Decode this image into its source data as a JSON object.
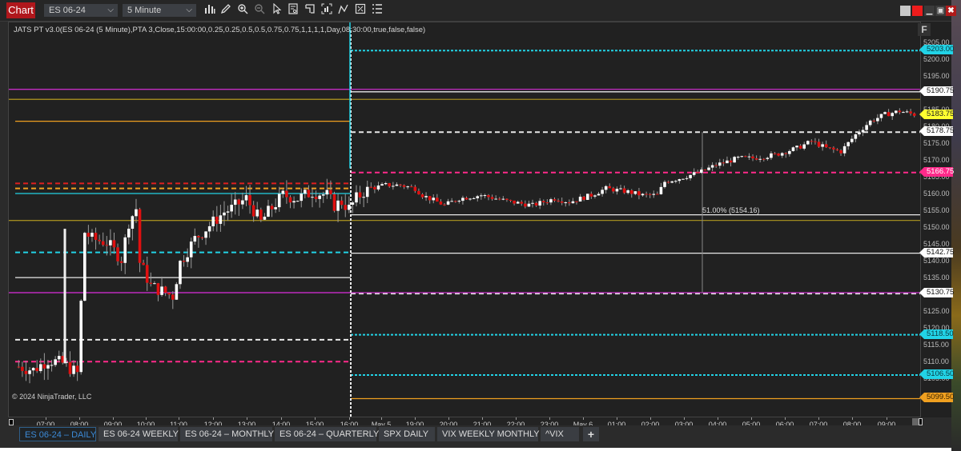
{
  "window": {
    "title_tab": "Chart",
    "instrument": "ES 06-24",
    "interval": "5 Minute",
    "toolbar_icons": [
      "bar-type-icon",
      "pencil-icon",
      "zoom-in-icon",
      "zoom-out-icon",
      "pointer-icon",
      "data-box-icon",
      "properties-icon",
      "chart-trader-icon",
      "strategy-icon",
      "indicators-icon",
      "list-icon"
    ],
    "window_buttons": [
      "gray-box",
      "red-box",
      "minimize",
      "maximize",
      "close"
    ],
    "f_button": "F"
  },
  "indicator_label": "JATS PT v3.0(ES 06-24 (5 Minute),PTA 3,Close,15:00:00,0.25,0.25,0.5,0.5,0.75,0.75,1,1,1,1,Day,08:30:00,true,false,false)",
  "copyright": "© 2024 NinjaTrader, LLC",
  "fib_label": "51.00% (5154.16)",
  "colors": {
    "background": "#212121",
    "up_candle": "#ffffff",
    "down_candle": "#e01010",
    "cyan": "#22d3e6",
    "magenta": "#c42cc4",
    "pink": "#ff2a8a",
    "gold": "#a08a20",
    "orange": "#f0a020",
    "red": "#e02020",
    "yellow": "#ffff30"
  },
  "y_axis": {
    "ticks": [
      "5205.00",
      "5200.00",
      "5195.00",
      "5185.00",
      "5180.00",
      "5175.00",
      "5170.00",
      "5165.00",
      "5160.00",
      "5155.00",
      "5150.00",
      "5145.00",
      "5140.00",
      "5135.00",
      "5125.00",
      "5120.00",
      "5115.00",
      "5110.00",
      "5105.00"
    ],
    "tick_values": [
      5205,
      5200,
      5195,
      5185,
      5180,
      5175,
      5170,
      5165,
      5160,
      5155,
      5150,
      5145,
      5140,
      5135,
      5125,
      5120,
      5115,
      5110,
      5105
    ]
  },
  "price_labels": [
    {
      "value": "5203.00",
      "style": "cyan"
    },
    {
      "value": "5190.75",
      "style": "white"
    },
    {
      "value": "5183.75",
      "style": "yellow"
    },
    {
      "value": "5178.75",
      "style": "white"
    },
    {
      "value": "5166.75",
      "style": "pink"
    },
    {
      "value": "5142.75",
      "style": "white"
    },
    {
      "value": "5130.75",
      "style": "white"
    },
    {
      "value": "5118.50",
      "style": "cyan"
    },
    {
      "value": "5106.50",
      "style": "cyan"
    },
    {
      "value": "5099.50",
      "style": "orange"
    }
  ],
  "x_axis": {
    "ticks": [
      "07:00",
      "08:00",
      "09:00",
      "10:00",
      "11:00",
      "12:00",
      "13:00",
      "14:00",
      "15:00",
      "16:00",
      "May 5",
      "19:00",
      "20:00",
      "21:00",
      "22:00",
      "23:00",
      "May 6",
      "01:00",
      "02:00",
      "03:00",
      "04:00",
      "05:00",
      "06:00",
      "07:00",
      "08:00",
      "09:00"
    ]
  },
  "chart_tabs": [
    {
      "label": "ES 06-24 – DAILY",
      "active": true
    },
    {
      "label": "ES 06-24 WEEKLY",
      "active": false
    },
    {
      "label": "ES 06-24 – MONTHLY",
      "active": false
    },
    {
      "label": "ES 06-24 – QUARTERLY",
      "active": false
    },
    {
      "label": "SPX DAILY",
      "active": false
    },
    {
      "label": "VIX WEEKLY MONTHLY",
      "active": false
    },
    {
      "label": "^VIX",
      "active": false
    }
  ],
  "add_tab": "+",
  "chart_data": {
    "type": "candlestick",
    "instrument": "ES 06-24",
    "interval": "5 Minute",
    "y_range": [
      5097,
      5209
    ],
    "levels_current_session": [
      {
        "price": 5203.0,
        "color": "cyan",
        "style": "dashed"
      },
      {
        "price": 5190.75,
        "color": "white",
        "style": "solid"
      },
      {
        "price": 5191.5,
        "color": "magenta",
        "style": "solid"
      },
      {
        "price": 5188.5,
        "color": "gold",
        "style": "solid"
      },
      {
        "price": 5178.75,
        "color": "white",
        "style": "dashed"
      },
      {
        "price": 5166.75,
        "color": "pink",
        "style": "dashed"
      },
      {
        "price": 5154.16,
        "color": "white",
        "style": "solid",
        "label": "51.00%"
      },
      {
        "price": 5152.5,
        "color": "gold",
        "style": "solid"
      },
      {
        "price": 5142.75,
        "color": "white",
        "style": "solid"
      },
      {
        "price": 5130.75,
        "color": "white",
        "style": "dashed"
      },
      {
        "price": 5131.0,
        "color": "magenta",
        "style": "solid"
      },
      {
        "price": 5118.5,
        "color": "cyan",
        "style": "dashed"
      },
      {
        "price": 5106.5,
        "color": "cyan",
        "style": "dashed"
      },
      {
        "price": 5099.5,
        "color": "orange",
        "style": "solid"
      }
    ],
    "levels_prior_session": [
      {
        "price": 5191.5,
        "color": "magenta",
        "style": "solid"
      },
      {
        "price": 5188.5,
        "color": "gold",
        "style": "solid"
      },
      {
        "price": 5182.0,
        "color": "orange",
        "style": "solid"
      },
      {
        "price": 5163.5,
        "color": "red",
        "style": "dashed"
      },
      {
        "price": 5162.0,
        "color": "orange",
        "style": "dashed"
      },
      {
        "price": 5160.5,
        "color": "cyan",
        "style": "solid"
      },
      {
        "price": 5152.5,
        "color": "gold",
        "style": "solid"
      },
      {
        "price": 5143.0,
        "color": "cyan",
        "style": "dashed"
      },
      {
        "price": 5135.5,
        "color": "white",
        "style": "solid"
      },
      {
        "price": 5131.0,
        "color": "magenta",
        "style": "solid"
      },
      {
        "price": 5117.0,
        "color": "white",
        "style": "dashed"
      },
      {
        "price": 5110.5,
        "color": "pink",
        "style": "dashed"
      }
    ],
    "close_path": [
      [
        0,
        5109
      ],
      [
        4,
        5108
      ],
      [
        8,
        5111
      ],
      [
        12,
        5110
      ],
      [
        16,
        5107
      ],
      [
        18,
        5149
      ],
      [
        20,
        5147
      ],
      [
        24,
        5146
      ],
      [
        28,
        5141
      ],
      [
        30,
        5152
      ],
      [
        32,
        5156
      ],
      [
        33,
        5140
      ],
      [
        36,
        5133
      ],
      [
        40,
        5131
      ],
      [
        42,
        5130
      ],
      [
        44,
        5140
      ],
      [
        48,
        5147
      ],
      [
        52,
        5151
      ],
      [
        56,
        5155
      ],
      [
        58,
        5156
      ],
      [
        62,
        5159
      ],
      [
        66,
        5152
      ],
      [
        68,
        5155
      ],
      [
        72,
        5160
      ],
      [
        76,
        5159
      ],
      [
        80,
        5161
      ],
      [
        84,
        5160
      ],
      [
        86,
        5157
      ],
      [
        88,
        5158
      ],
      [
        90,
        5156
      ],
      [
        92,
        5159
      ],
      [
        94,
        5161
      ],
      [
        96,
        5162
      ],
      [
        100,
        5163
      ],
      [
        104,
        5163
      ],
      [
        108,
        5162
      ],
      [
        110,
        5160
      ],
      [
        114,
        5158
      ],
      [
        116,
        5157
      ],
      [
        120,
        5159
      ],
      [
        126,
        5160
      ],
      [
        130,
        5159
      ],
      [
        134,
        5158
      ],
      [
        140,
        5157
      ],
      [
        146,
        5159
      ],
      [
        150,
        5158
      ],
      [
        156,
        5160
      ],
      [
        160,
        5162
      ],
      [
        166,
        5161
      ],
      [
        170,
        5160
      ],
      [
        174,
        5160
      ],
      [
        176,
        5164
      ],
      [
        180,
        5165
      ],
      [
        186,
        5167
      ],
      [
        190,
        5169
      ],
      [
        196,
        5171
      ],
      [
        200,
        5171
      ],
      [
        206,
        5172
      ],
      [
        212,
        5174
      ],
      [
        216,
        5176
      ],
      [
        220,
        5174
      ],
      [
        224,
        5173
      ],
      [
        228,
        5178
      ],
      [
        232,
        5182
      ],
      [
        236,
        5184
      ],
      [
        240,
        5185
      ],
      [
        244,
        5184
      ]
    ]
  }
}
